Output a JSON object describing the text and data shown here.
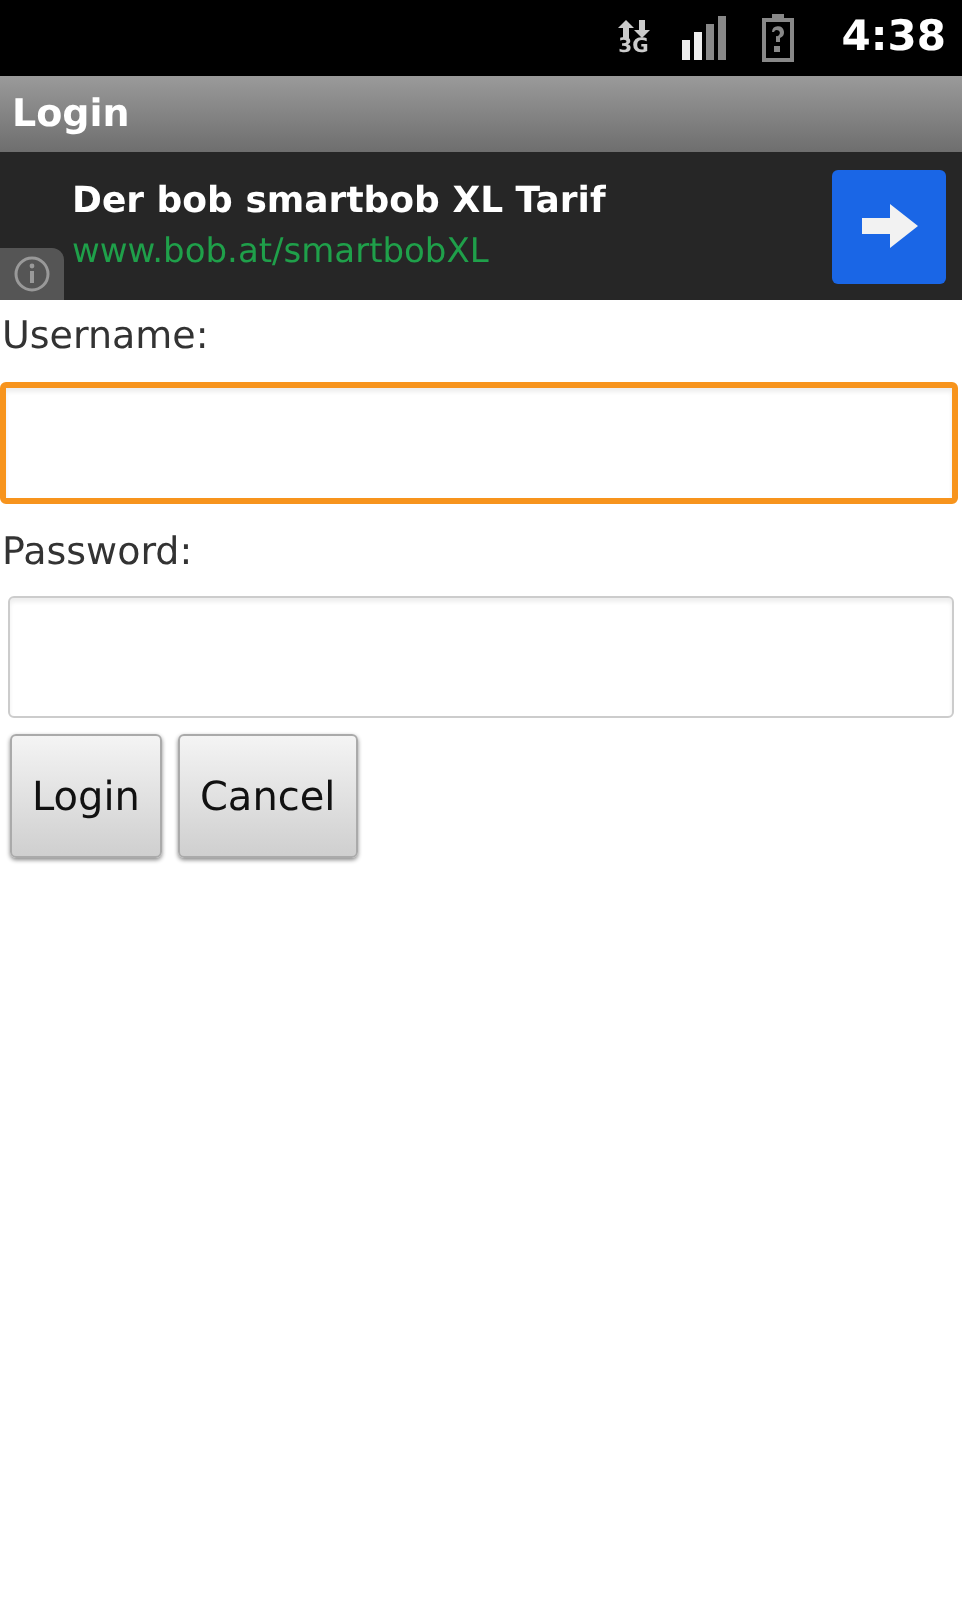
{
  "status_bar": {
    "network_type": "3G",
    "time": "4:38"
  },
  "window": {
    "title": "Login"
  },
  "ad": {
    "headline": "Der bob smartbob XL Tarif",
    "url": "www.bob.at/smartbobXL"
  },
  "fields": [
    {
      "label": "Username:",
      "focused": true
    },
    {
      "label": "Password:",
      "focused": false
    }
  ],
  "buttons": [
    "Login",
    "Cancel"
  ]
}
